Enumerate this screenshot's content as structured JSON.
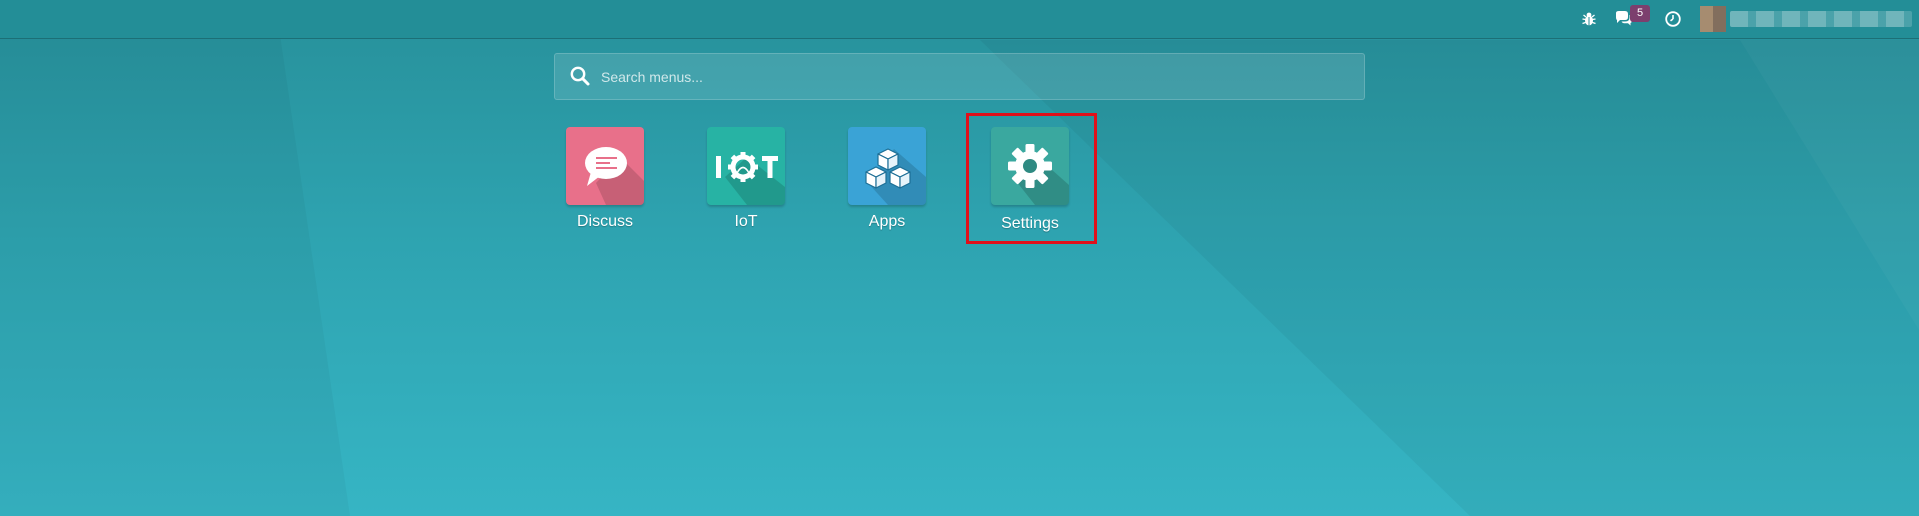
{
  "navbar": {
    "debug_icon": "bug-icon",
    "chat_icon": "chat-icon",
    "chat_badge": "5",
    "activity_icon": "clock-icon",
    "user_name": "",
    "colors": {
      "background": "#238e97",
      "badge": "#7c3f6e"
    }
  },
  "search": {
    "icon": "search-icon",
    "placeholder": "Search menus...",
    "value": ""
  },
  "apps": [
    {
      "label": "Discuss",
      "icon": "speech-bubble-icon",
      "color": "#e8708a"
    },
    {
      "label": "IoT",
      "icon": "iot-icon",
      "color": "#27b3a4"
    },
    {
      "label": "Apps",
      "icon": "cubes-icon",
      "color": "#3aa3d6"
    },
    {
      "label": "Settings",
      "icon": "gear-icon",
      "color": "#3aa89f",
      "highlighted": true
    }
  ],
  "colors": {
    "highlight": "#e0101a"
  }
}
